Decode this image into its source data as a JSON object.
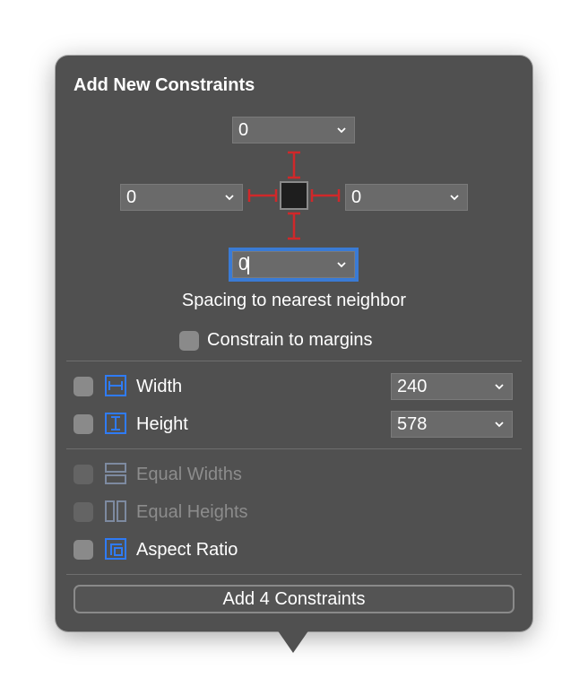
{
  "title": "Add New Constraints",
  "spacing": {
    "top": "0",
    "left": "0",
    "right": "0",
    "bottom": "0",
    "caption": "Spacing to nearest neighbor"
  },
  "constrain_to_margins": {
    "label": "Constrain to margins",
    "checked": false
  },
  "rows": {
    "width": {
      "label": "Width",
      "value": "240",
      "checked": false,
      "icon": "width-icon"
    },
    "height": {
      "label": "Height",
      "value": "578",
      "checked": false,
      "icon": "height-icon"
    },
    "equal_widths": {
      "label": "Equal Widths",
      "enabled": false,
      "icon": "equal-widths-icon"
    },
    "equal_heights": {
      "label": "Equal Heights",
      "enabled": false,
      "icon": "equal-heights-icon"
    },
    "aspect_ratio": {
      "label": "Aspect Ratio",
      "checked": false,
      "icon": "aspect-ratio-icon"
    }
  },
  "add_button": {
    "label": "Add 4 Constraints"
  },
  "colors": {
    "panel": "#505050",
    "strut": "#d0282a",
    "icon_blue": "#2f7bf5",
    "focus_ring": "#3a7bd5"
  }
}
